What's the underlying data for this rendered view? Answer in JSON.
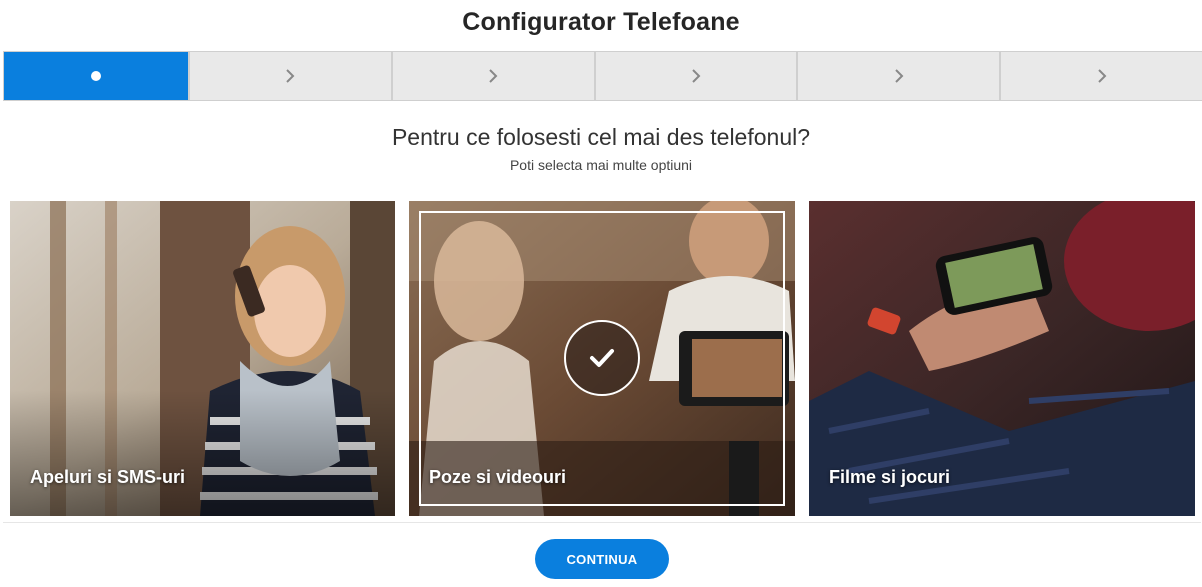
{
  "page": {
    "title": "Configurator Telefoane"
  },
  "stepper": {
    "steps": [
      {
        "icon": "dot-icon",
        "active": true
      },
      {
        "icon": "chevron-right-icon",
        "active": false
      },
      {
        "icon": "chevron-right-icon",
        "active": false
      },
      {
        "icon": "chevron-right-icon",
        "active": false
      },
      {
        "icon": "chevron-right-icon",
        "active": false
      },
      {
        "icon": "chevron-right-icon",
        "active": false
      }
    ]
  },
  "question": {
    "title": "Pentru ce folosesti cel mai des telefonul?",
    "hint": "Poti selecta mai multe optiuni"
  },
  "options": [
    {
      "label": "Apeluri si SMS-uri",
      "selected": false
    },
    {
      "label": "Poze si videouri",
      "selected": true,
      "icon": "check-icon"
    },
    {
      "label": "Filme si jocuri",
      "selected": false
    }
  ],
  "footer": {
    "continue_label": "CONTINUA"
  },
  "colors": {
    "accent": "#0a7fde",
    "step_inactive": "#e9e9e9"
  }
}
